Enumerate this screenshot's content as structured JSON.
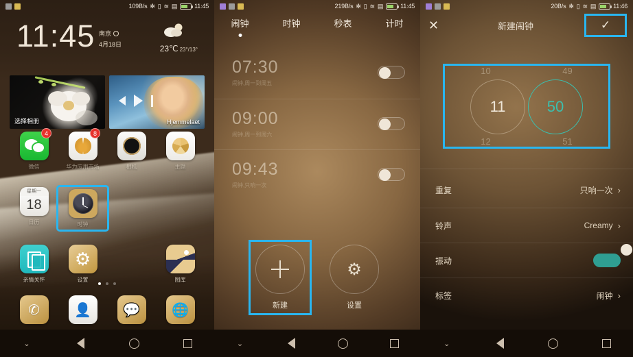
{
  "phone1": {
    "status": {
      "speed": "109B/s",
      "time": "11:45",
      "icons": [
        "bluetooth-icon",
        "vibrate-icon",
        "wifi-icon",
        "sim-icon",
        "battery-icon"
      ]
    },
    "widget": {
      "time": "11:45",
      "city": "南京",
      "date": "4月18日",
      "temp": "23℃",
      "range": "23°/13°"
    },
    "cards": [
      {
        "label": "选择相册"
      },
      {
        "label": "Hjemmelaet"
      }
    ],
    "apps_row1": [
      {
        "name": "微信",
        "icon": "wechat-icon",
        "badge": "4"
      },
      {
        "name": "华为应用市场",
        "icon": "huawei-icon",
        "badge": "8"
      },
      {
        "name": "相机",
        "icon": "camera-icon",
        "badge": ""
      },
      {
        "name": "主题",
        "icon": "themes-icon",
        "badge": ""
      }
    ],
    "apps_row2": [
      {
        "name": "日历",
        "icon": "calendar-icon",
        "cal_week": "星期一",
        "cal_day": "18"
      },
      {
        "name": "时钟",
        "icon": "clock-icon",
        "highlighted": true
      },
      {
        "name": "",
        "icon": ""
      },
      {
        "name": "",
        "icon": ""
      }
    ],
    "apps_row3": [
      {
        "name": "亲情关怀",
        "icon": "multi-window-icon"
      },
      {
        "name": "设置",
        "icon": "settings-gear-icon"
      },
      {
        "name": "",
        "icon": ""
      },
      {
        "name": "图库",
        "icon": "gallery-icon"
      }
    ],
    "dock": [
      {
        "name": "",
        "icon": "phone-icon"
      },
      {
        "name": "",
        "icon": "contacts-icon"
      },
      {
        "name": "",
        "icon": "messages-icon"
      },
      {
        "name": "",
        "icon": "browser-icon"
      }
    ],
    "page_dots": 3,
    "page_active": 0
  },
  "phone2": {
    "status": {
      "speed": "219B/s",
      "time": "11:45"
    },
    "tabs": [
      {
        "label": "闹钟",
        "selected": true
      },
      {
        "label": "时钟",
        "selected": false
      },
      {
        "label": "秒表",
        "selected": false
      },
      {
        "label": "计时",
        "selected": false
      }
    ],
    "alarms": [
      {
        "time": "07:30",
        "sub": "闹钟,周一到周五",
        "on": false
      },
      {
        "time": "09:00",
        "sub": "闹钟,周一到周六",
        "on": false
      },
      {
        "time": "09:43",
        "sub": "闹钟,只响一次",
        "on": false
      }
    ],
    "buttons": [
      {
        "label": "新建",
        "icon": "plus-icon",
        "highlighted": true
      },
      {
        "label": "设置",
        "icon": "gear-icon",
        "highlighted": false
      }
    ]
  },
  "phone3": {
    "status": {
      "speed": "20B/s",
      "time": "11:46"
    },
    "header": {
      "close": "✕",
      "title": "新建闹钟",
      "confirm": "✓",
      "confirm_highlighted": true
    },
    "picker": {
      "hour_above": "10",
      "hour": "11",
      "hour_below": "12",
      "minute_above": "49",
      "minute": "50",
      "minute_below": "51",
      "highlighted": true,
      "accent": "#3bbfae"
    },
    "rows": [
      {
        "label": "重复",
        "value": "只响一次",
        "type": "chevron"
      },
      {
        "label": "铃声",
        "value": "Creamy",
        "type": "chevron"
      },
      {
        "label": "振动",
        "value": "",
        "type": "toggle",
        "on": true
      },
      {
        "label": "标签",
        "value": "闹钟",
        "type": "chevron"
      }
    ]
  },
  "navbar": {
    "collapse": "⌄",
    "back": "back-triangle-icon",
    "home": "home-circle-icon",
    "recents": "recents-square-icon"
  },
  "colors": {
    "highlight": "#29b6f0",
    "accent_teal": "#3bbfae",
    "badge_red": "#e8302a"
  }
}
